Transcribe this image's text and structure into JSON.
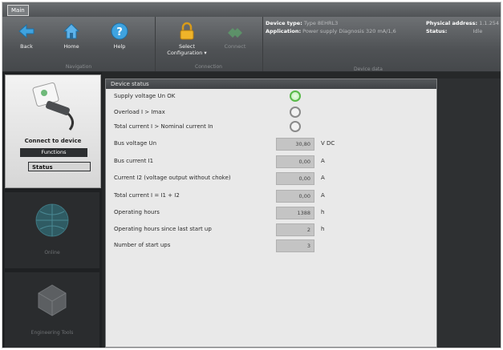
{
  "app": {
    "tab_label": "Main"
  },
  "ribbon": {
    "navigation": {
      "caption": "Navigation",
      "buttons": [
        {
          "label": "Back",
          "icon": "back-arrow-icon"
        },
        {
          "label": "Home",
          "icon": "home-icon"
        },
        {
          "label": "Help",
          "icon": "help-icon"
        }
      ]
    },
    "connection": {
      "caption": "Connection",
      "buttons": [
        {
          "label": "Select Configuration ▾",
          "icon": "lock-icon"
        },
        {
          "label": "Connect",
          "icon": "connect-plug-icon"
        }
      ]
    },
    "device": {
      "caption": "Device data",
      "device_type_label": "Device type:",
      "device_type_value": "Type 8EHRL3",
      "application_label": "Application:",
      "application_value": "Power supply Diagnosis 320 mA/1,6",
      "physical_address_label": "Physical address:",
      "physical_address_value": "1.1.254",
      "status_label": "Status:",
      "status_value": "Idle"
    }
  },
  "leftnav": {
    "connect_label": "Connect to device",
    "functions_label": "Functions",
    "status_label": "Status",
    "tile2_label": "Online",
    "tile3_label": "Engineering Tools"
  },
  "panel": {
    "title": "Device status",
    "rows": [
      {
        "label": "Supply voltage Un OK",
        "kind": "led",
        "state": "on"
      },
      {
        "label": "Overload I > Imax",
        "kind": "led",
        "state": "off"
      },
      {
        "label": "Total current I > Nominal current In",
        "kind": "led",
        "state": "off"
      },
      {
        "label": "Bus voltage Un",
        "kind": "value",
        "value": "30,80",
        "unit": "V DC"
      },
      {
        "label": "Bus current I1",
        "kind": "value",
        "value": "0,00",
        "unit": "A"
      },
      {
        "label": "Current I2 (voltage output without choke)",
        "kind": "value",
        "value": "0,00",
        "unit": "A"
      },
      {
        "label": "Total current I = I1 + I2",
        "kind": "value",
        "value": "0,00",
        "unit": "A"
      },
      {
        "label": "Operating hours",
        "kind": "value",
        "value": "1388",
        "unit": "h"
      },
      {
        "label": "Operating hours since last start up",
        "kind": "value",
        "value": "2",
        "unit": "h"
      },
      {
        "label": "Number of start ups",
        "kind": "value",
        "value": "3",
        "unit": ""
      }
    ]
  },
  "colors": {
    "led_ok": "#58b948",
    "led_off": "#8a8a8a",
    "ribbon": "#4f5255"
  }
}
